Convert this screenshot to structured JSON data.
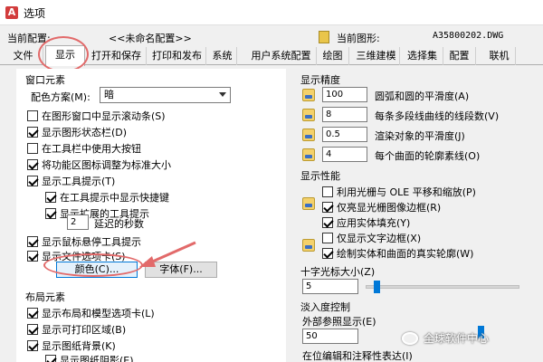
{
  "window": {
    "title": "选项"
  },
  "config": {
    "current_config_label": "当前配置:",
    "current_config_value": "<<未命名配置>>",
    "current_drawing_label": "当前图形:",
    "current_drawing_value": "A35800202.DWG"
  },
  "tabs": [
    "文件",
    "显示",
    "打开和保存",
    "打印和发布",
    "系统",
    "用户系统配置",
    "绘图",
    "三维建模",
    "选择集",
    "配置",
    "联机"
  ],
  "window_elements": {
    "group_title": "窗口元素",
    "color_scheme_label": "配色方案(M):",
    "color_scheme_value": "暗",
    "checks": [
      {
        "label": "在图形窗口中显示滚动条(S)",
        "checked": false
      },
      {
        "label": "显示图形状态栏(D)",
        "checked": true
      },
      {
        "label": "在工具栏中使用大按钮",
        "checked": false
      },
      {
        "label": "将功能区图标调整为标准大小",
        "checked": true
      },
      {
        "label": "显示工具提示(T)",
        "checked": true
      },
      {
        "label": "在工具提示中显示快捷键",
        "checked": true
      },
      {
        "label": "显示扩展的工具提示",
        "checked": true
      },
      {
        "label": "显示鼠标悬停工具提示",
        "checked": true
      },
      {
        "label": "显示文件选项卡(S)",
        "checked": true
      }
    ],
    "delay_value": "2",
    "delay_label": "延迟的秒数",
    "colors_button": "颜色(C)...",
    "fonts_button": "字体(F)..."
  },
  "layout_elements": {
    "group_title": "布局元素",
    "checks": [
      {
        "label": "显示布局和模型选项卡(L)",
        "checked": true
      },
      {
        "label": "显示可打印区域(B)",
        "checked": true
      },
      {
        "label": "显示图纸背景(K)",
        "checked": true
      },
      {
        "label": "显示图纸阴影(E)",
        "checked": true
      }
    ]
  },
  "display_resolution": {
    "group_title": "显示精度",
    "rows": [
      {
        "value": "100",
        "label": "圆弧和圆的平滑度(A)"
      },
      {
        "value": "8",
        "label": "每条多段线曲线的线段数(V)"
      },
      {
        "value": "0.5",
        "label": "渲染对象的平滑度(J)"
      },
      {
        "value": "4",
        "label": "每个曲面的轮廓素线(O)"
      }
    ]
  },
  "display_performance": {
    "group_title": "显示性能",
    "checks": [
      {
        "label": "利用光栅与 OLE 平移和缩放(P)",
        "checked": false
      },
      {
        "label": "仅亮显光栅图像边框(R)",
        "checked": true
      },
      {
        "label": "应用实体填充(Y)",
        "checked": true
      },
      {
        "label": "仅显示文字边框(X)",
        "checked": false
      },
      {
        "label": "绘制实体和曲面的真实轮廓(W)",
        "checked": true
      }
    ]
  },
  "crosshair": {
    "label": "十字光标大小(Z)",
    "value": "5",
    "fraction": 0.05
  },
  "fade_control": {
    "group_title": "淡入度控制",
    "xref_label": "外部参照显示(E)",
    "xref_value": "50",
    "inplace_label": "在位编辑和注释性表达(I)"
  },
  "watermark": {
    "text": "全球软件中心"
  },
  "colors": {
    "accent": "#0078d7",
    "annotation": "#e26a6a"
  }
}
